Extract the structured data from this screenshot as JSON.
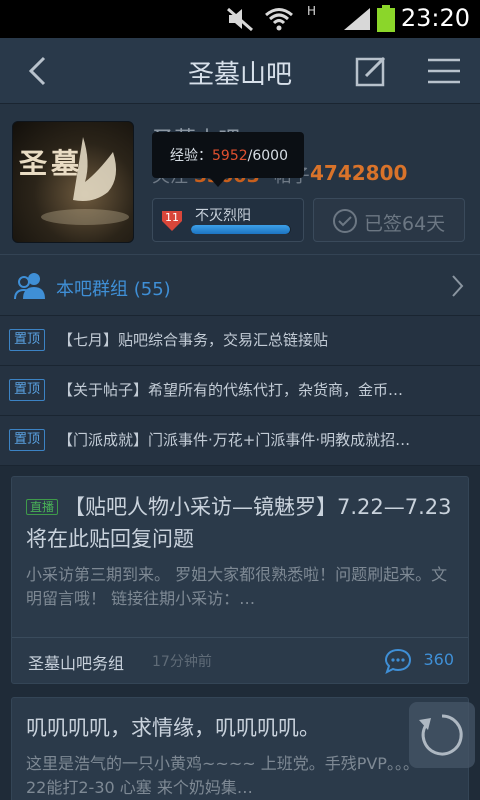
{
  "status_bar": {
    "time": "23:20",
    "network_label": "H"
  },
  "nav": {
    "title": "圣墓山吧"
  },
  "forum": {
    "logo_text": "圣墓",
    "name": "圣墓山吧",
    "follow_label": "关注",
    "follow_count": "53003",
    "post_label": "帖子",
    "post_count": "4742800"
  },
  "tooltip": {
    "label": "经验：",
    "current": "5952",
    "separator": "/",
    "total": "6000"
  },
  "level": {
    "number": "11",
    "name": "不灭烈阳",
    "progress": 0.992
  },
  "signed": {
    "label": "已签64天"
  },
  "group": {
    "label": "本吧群组 (55)"
  },
  "top_posts": [
    {
      "badge": "置顶",
      "title": "【七月】贴吧综合事务，交易汇总链接贴"
    },
    {
      "badge": "置顶",
      "title": "【关于帖子】希望所有的代练代打，杂货商，金币…"
    },
    {
      "badge": "置顶",
      "title": "【门派成就】门派事件·万花+门派事件·明教成就招…"
    }
  ],
  "posts": [
    {
      "badge": "直播",
      "title": "【贴吧人物小采访—镜魅罗】7.22—7.23将在此贴回复问题",
      "excerpt": "小采访第三期到来。 罗姐大家都很熟悉啦！问题刷起来。文明留言哦！ 链接往期小采访：…",
      "author": "圣墓山吧务组",
      "time": "17分钟前",
      "replies": "360"
    },
    {
      "title": "叽叽叽叽，求情缘，叽叽叽叽。",
      "excerpt": "这里是浩气的一只小黄鸡~~~~ 上班党。手残PVP。。。22能打2-30 心塞 来个奶妈集…"
    }
  ],
  "colors": {
    "accent_blue": "#3f8fd6",
    "orange": "#d9732a",
    "live_green": "#49b257"
  }
}
